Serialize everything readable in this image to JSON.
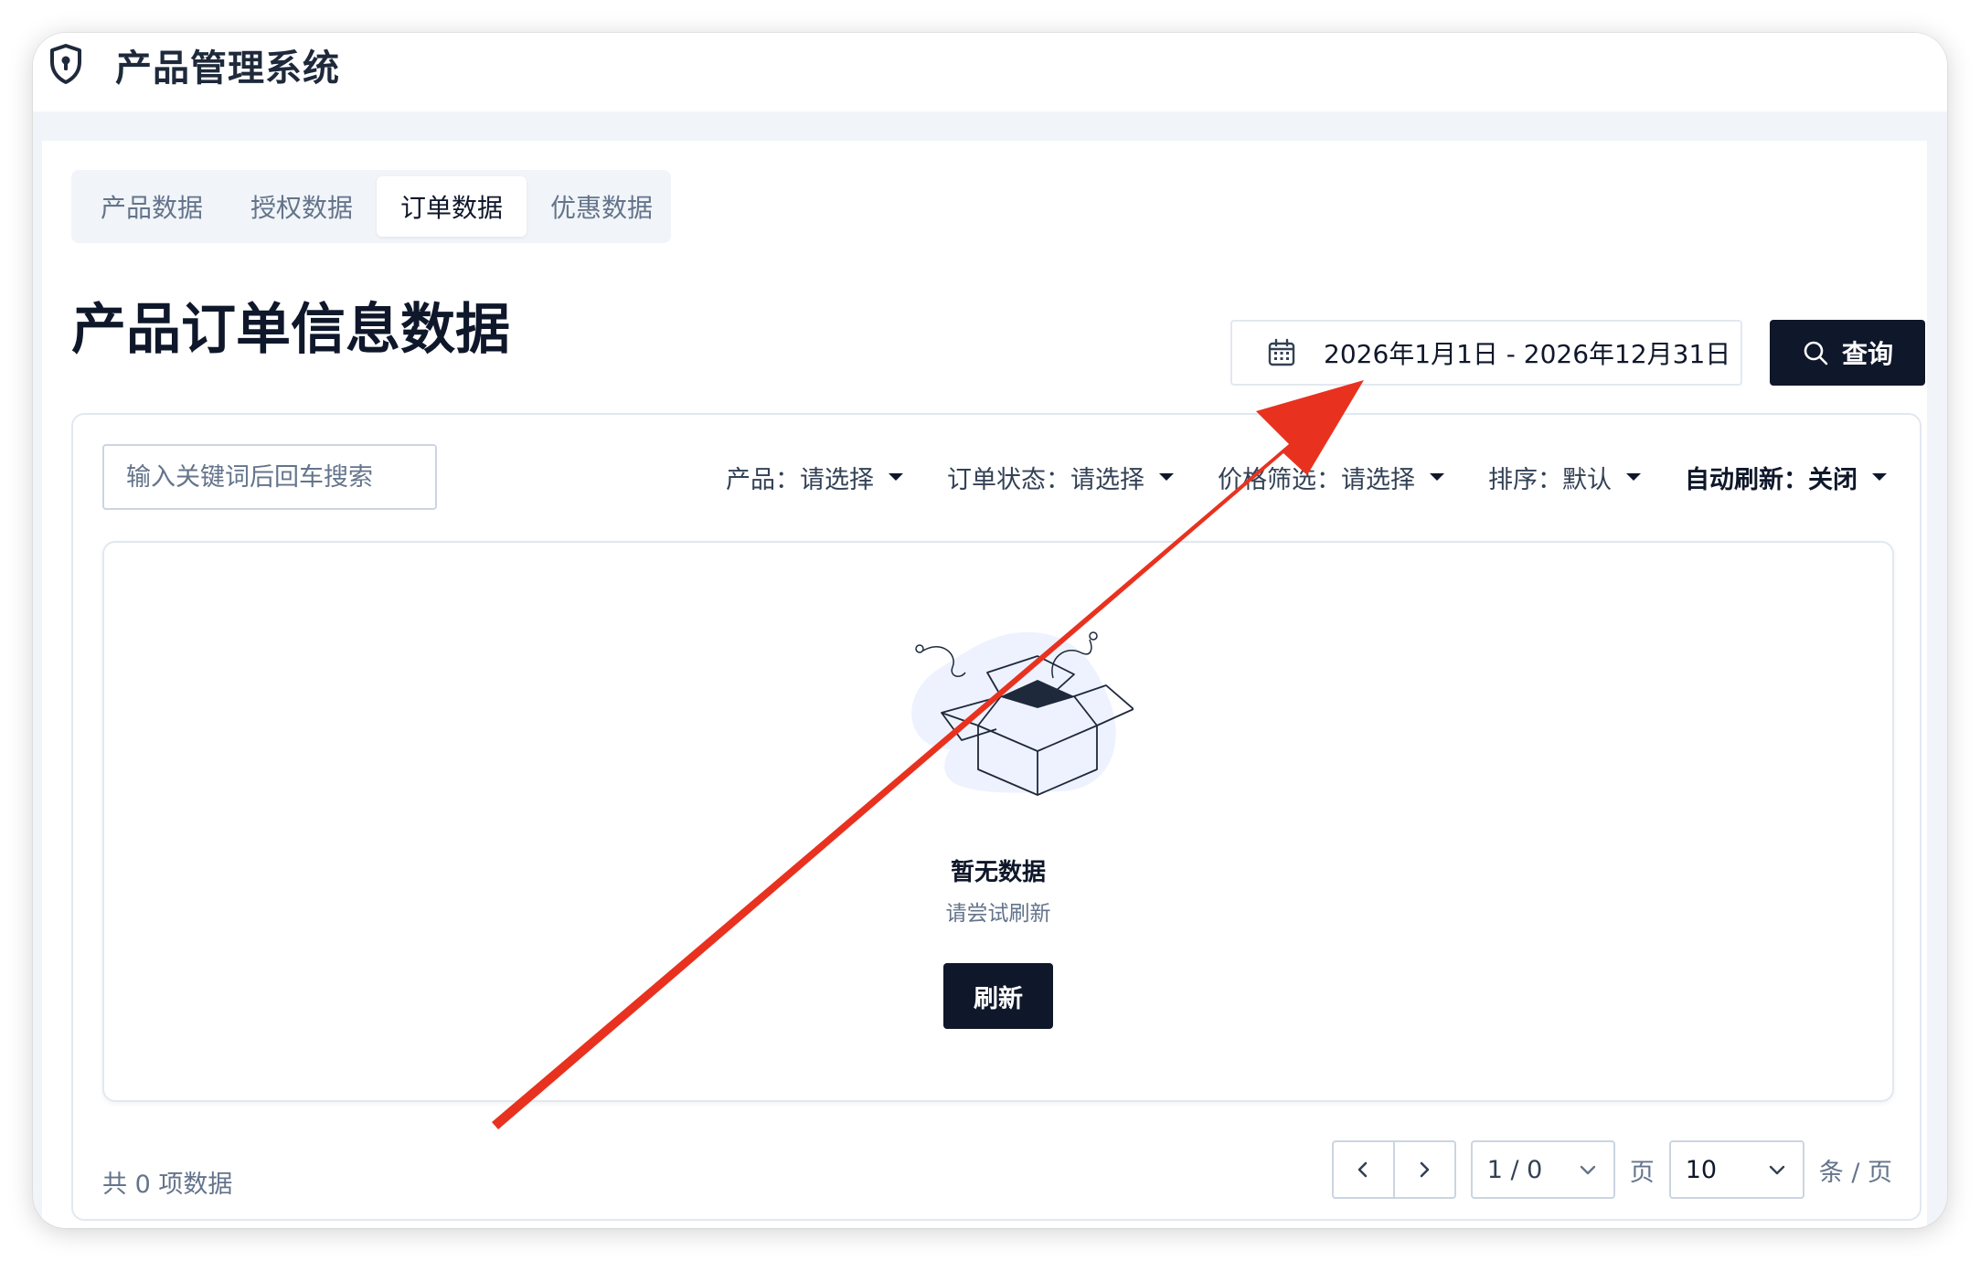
{
  "app": {
    "title": "产品管理系统",
    "logo_icon": "shield-keyhole-icon"
  },
  "tabs": [
    {
      "label": "产品数据",
      "active": false
    },
    {
      "label": "授权数据",
      "active": false
    },
    {
      "label": "订单数据",
      "active": true
    },
    {
      "label": "优惠数据",
      "active": false
    }
  ],
  "page": {
    "title": "产品订单信息数据"
  },
  "date_range": {
    "value": "2026年1月1日 - 2026年12月31日",
    "icon": "calendar-icon"
  },
  "query_button": {
    "label": "查询",
    "icon": "search-icon"
  },
  "search": {
    "placeholder": "输入关键词后回车搜索",
    "value": ""
  },
  "filters": [
    {
      "label": "产品：请选择"
    },
    {
      "label": "订单状态：请选择"
    },
    {
      "label": "价格筛选：请选择"
    },
    {
      "label": "排序：默认"
    },
    {
      "label": "自动刷新：关闭"
    }
  ],
  "empty_state": {
    "title": "暂无数据",
    "subtitle": "请尝试刷新",
    "button_label": "刷新"
  },
  "footer": {
    "total_text": "共 0 项数据",
    "page_value": "1 / 0",
    "page_suffix": "页",
    "page_size": "10",
    "page_size_suffix": "条 / 页"
  },
  "colors": {
    "primary": "#0f172a",
    "annotation_arrow": "#e8321f",
    "illustration_bg": "#eef2ff"
  }
}
